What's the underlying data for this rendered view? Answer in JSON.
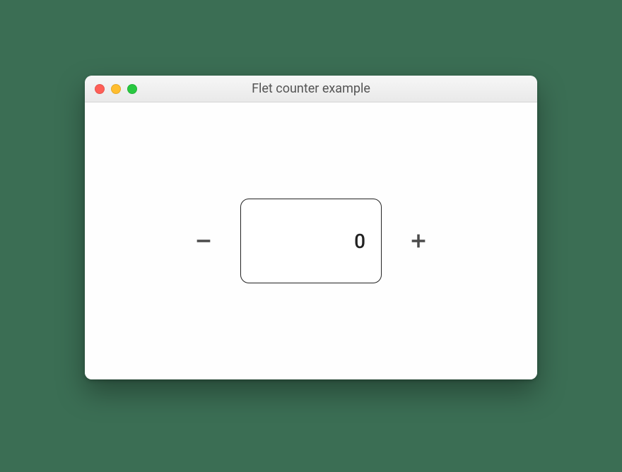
{
  "window": {
    "title": "Flet counter example",
    "traffic_lights": {
      "close": "close",
      "minimize": "minimize",
      "fullscreen": "fullscreen"
    }
  },
  "counter": {
    "value": "0",
    "decrement_label": "Remove",
    "increment_label": "Add"
  },
  "icons": {
    "minus": "remove-icon",
    "plus": "add-icon"
  },
  "colors": {
    "background": "#3b6e54",
    "window_bg": "#fcfcfc",
    "red": "#ff5f57",
    "yellow": "#ffbd2e",
    "green": "#28c840",
    "icon": "#4b4b4b",
    "border": "#222222"
  }
}
